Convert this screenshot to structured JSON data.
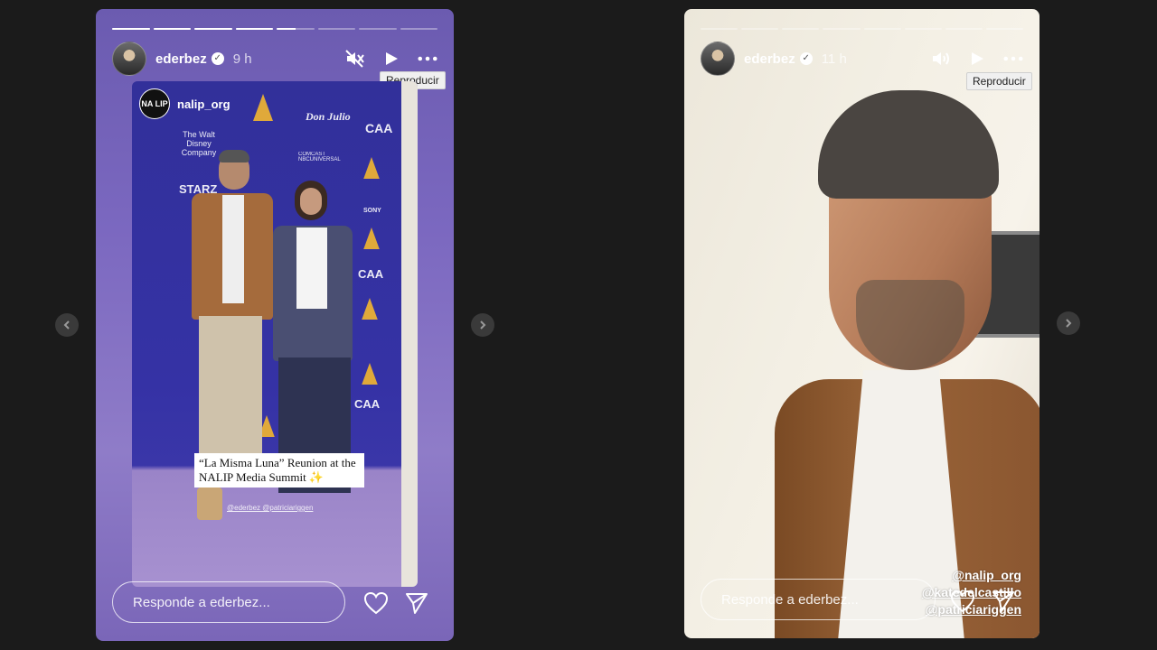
{
  "story_left": {
    "progress": [
      1,
      1,
      1,
      1,
      0.5,
      0,
      0,
      0
    ],
    "username": "ederbez",
    "time": "9 h",
    "tooltip": "Reproducir",
    "photo": {
      "tag_logo": "NA LIP",
      "tag_name": "nalip_org",
      "banner_logos": [
        "COMCAST NBCUNIVERSAL",
        "Don Julio",
        "CAA",
        "The Walt Disney Company",
        "STARZ",
        "SONY"
      ],
      "caption": "“La Misma Luna” Reunion at the NALIP Media Summit ✨",
      "mentions": "@ederbez @patriciariggen"
    },
    "reply_placeholder": "Responde a ederbez..."
  },
  "story_right": {
    "progress": [
      0,
      0,
      0,
      0,
      0,
      0,
      0,
      0
    ],
    "username": "ederbez",
    "time": "11 h",
    "tooltip": "Reproducir",
    "mentions": [
      "@nalip_org",
      "@katedelcastillo",
      "@patriciariggen"
    ],
    "reply_placeholder": "Responde a ederbez..."
  },
  "icons": {
    "mute": "speaker-muted-icon",
    "sound": "speaker-icon",
    "play": "play-icon",
    "more": "more-icon",
    "heart": "heart-icon",
    "send": "send-icon",
    "next": "chevron-right-icon",
    "prev": "chevron-left-icon"
  }
}
